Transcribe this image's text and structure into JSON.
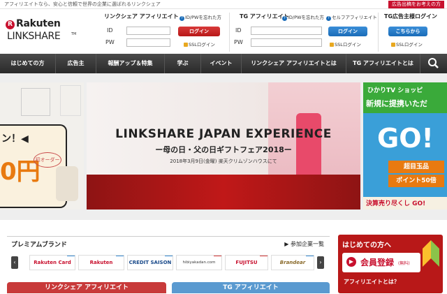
{
  "topbar": {
    "tagline": "アフィリエイトなら、安心と信頼で世界の企業に選ばれるリンクシェア",
    "advertiser_link": "広告出稿をお考えの方"
  },
  "logo": {
    "mark": "R",
    "line1": "Rakuten",
    "line2": "LINKSHARE",
    "tm": "TM"
  },
  "login_linkshare": {
    "title": "リンクシェア アフィリエイト",
    "forgot": "ID/PWを忘れた方",
    "id_label": "ID",
    "pw_label": "PW",
    "button": "ログイン",
    "ssl": "SSLログイン"
  },
  "login_tg": {
    "title": "TG アフィリエイト",
    "forgot": "ID/PWを忘れた方",
    "self": "セルフアフィリエイト",
    "id_label": "ID",
    "pw_label": "PW",
    "button": "ログイン",
    "ssl": "SSLログイン"
  },
  "login_advertiser": {
    "title": "TG広告主様ログイン",
    "button": "こちらから",
    "ssl": "SSLログイン"
  },
  "nav": [
    "はじめての方",
    "広告主",
    "報酬アップ＆特集",
    "学ぶ",
    "イベント",
    "リンクシェア アフィリエイトとは",
    "TG アフィリエイトとは"
  ],
  "hero": {
    "left_text1": "ン！◀",
    "left_badge": "初オーダー",
    "left_price": "0円",
    "title": "LINKSHARE JAPAN EXPERIENCE",
    "subtitle": "ー母の日・父の日ギフトフェア2018ー",
    "date": "2018年3月9日(金曜) 楽天クリムゾンハウスにて",
    "right_brand": "ひかりTV ショッピ",
    "right_head": "新規に提携いただ",
    "right_go": "GO!",
    "right_badge1": "超目玉品",
    "right_badge2": "ポイント50倍",
    "right_foot": "決算売り尽くし GO!"
  },
  "carousel": {
    "count": 9,
    "active": 0
  },
  "premium": {
    "title": "プレミアムブランド",
    "more": "参加企業一覧",
    "brands": [
      {
        "name": "Rakuten Card",
        "tag": "TG",
        "color": "#c8102e"
      },
      {
        "name": "Rakuten",
        "tag": "TG",
        "color": "#c8102e"
      },
      {
        "name": "CREDIT SAISON",
        "tag": "TG",
        "color": "#1a4a8a"
      },
      {
        "name": "hibiyakadan.com",
        "tag": "LS",
        "color": "#3a3a3a"
      },
      {
        "name": "FUJITSU",
        "tag": "LS",
        "color": "#c8102e"
      },
      {
        "name": "Brandear",
        "tag": "TG",
        "color": "#8a6a2a"
      }
    ]
  },
  "side": {
    "heading": "はじめての方へ",
    "register": "会員登録",
    "register_note": "(無料)",
    "foot": "アフィリエイトとは？"
  },
  "tabs": {
    "linkshare": "リンクシェア アフィリエイト",
    "tg": "TG アフィリエイト"
  }
}
